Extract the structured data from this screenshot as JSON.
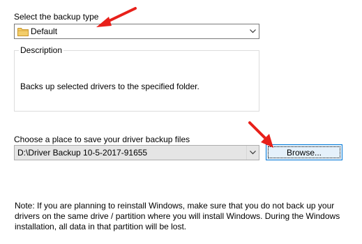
{
  "backup_type": {
    "label": "Select the backup type",
    "selected": "Default",
    "folder_icon_color": "#e8b84a"
  },
  "description": {
    "legend": "Description",
    "text": "Backs up selected drivers to the specified folder."
  },
  "save_location": {
    "label": "Choose a place to save your driver backup files",
    "path": "D:\\Driver Backup 10-5-2017-91655",
    "browse_label": "Browse..."
  },
  "note": {
    "text": "Note: If you are planning to reinstall Windows, make sure that you do not back up your drivers on the same drive / partition where you will install Windows. During the Windows installation, all data in that partition will be lost."
  },
  "colors": {
    "annotation_arrow": "#e8201a",
    "focus_border": "#0078d7"
  }
}
